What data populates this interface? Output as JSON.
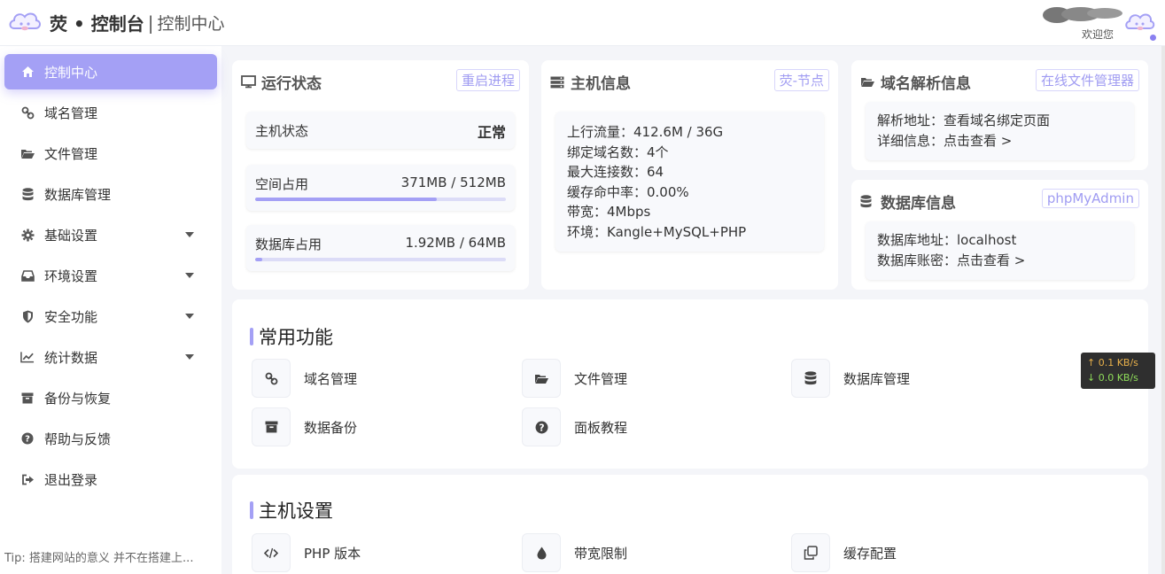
{
  "header": {
    "brand": "荧 • 控制台",
    "separator": "|",
    "subtitle": "控制中心",
    "welcome": "欢迎您"
  },
  "sidebar": {
    "items": [
      {
        "label": "控制中心",
        "icon": "home-icon",
        "active": true
      },
      {
        "label": "域名管理",
        "icon": "link-icon"
      },
      {
        "label": "文件管理",
        "icon": "folder-open-icon"
      },
      {
        "label": "数据库管理",
        "icon": "database-icon"
      },
      {
        "label": "基础设置",
        "icon": "gear-icon",
        "caret": true
      },
      {
        "label": "环境设置",
        "icon": "inbox-icon",
        "caret": true
      },
      {
        "label": "安全功能",
        "icon": "shield-icon",
        "caret": true
      },
      {
        "label": "统计数据",
        "icon": "line-chart-icon",
        "caret": true
      },
      {
        "label": "备份与恢复",
        "icon": "archive-icon"
      },
      {
        "label": "帮助与反馈",
        "icon": "question-circle-icon"
      },
      {
        "label": "退出登录",
        "icon": "sign-out-icon"
      }
    ],
    "tip": "Tip: 搭建网站的意义 并不在搭建上..."
  },
  "run_status": {
    "title": "运行状态",
    "button": "重启进程",
    "host_label": "主机状态",
    "host_value": "正常",
    "space_label": "空间占用",
    "space_value": "371MB / 512MB",
    "space_fraction": 0.725,
    "db_label": "数据库占用",
    "db_value": "1.92MB / 64MB",
    "db_fraction": 0.03
  },
  "host_info": {
    "title": "主机信息",
    "button": "荧-节点",
    "lines": [
      "上行流量：412.6M / 36G",
      "绑定域名数：4个",
      "最大连接数：64",
      "缓存命中率：0.00%",
      "带宽：4Mbps",
      "环境：Kangle+MySQL+PHP"
    ]
  },
  "dns_info": {
    "title": "域名解析信息",
    "button": "在线文件管理器",
    "lines": [
      "解析地址：查看域名绑定页面",
      "详细信息：点击查看 >"
    ]
  },
  "db_info": {
    "title": "数据库信息",
    "button": "phpMyAdmin",
    "lines": [
      "数据库地址：localhost",
      "数据库账密：点击查看 >"
    ]
  },
  "common": {
    "title": "常用功能",
    "items": [
      {
        "label": "域名管理",
        "icon": "link-icon"
      },
      {
        "label": "文件管理",
        "icon": "folder-open-icon"
      },
      {
        "label": "数据库管理",
        "icon": "database-icon"
      },
      {
        "label": "数据备份",
        "icon": "archive-icon"
      },
      {
        "label": "面板教程",
        "icon": "question-circle-icon"
      }
    ]
  },
  "host_settings": {
    "title": "主机设置",
    "items": [
      {
        "label": "PHP 版本",
        "icon": "code-icon"
      },
      {
        "label": "带宽限制",
        "icon": "droplet-icon"
      },
      {
        "label": "缓存配置",
        "icon": "copy-icon"
      }
    ]
  },
  "speed": {
    "up": "↑ 0.1 KB/s",
    "down": "↓ 0.0 KB/s"
  },
  "colors": {
    "accent": "#a4a0f5",
    "background": "#f4f5f9"
  }
}
